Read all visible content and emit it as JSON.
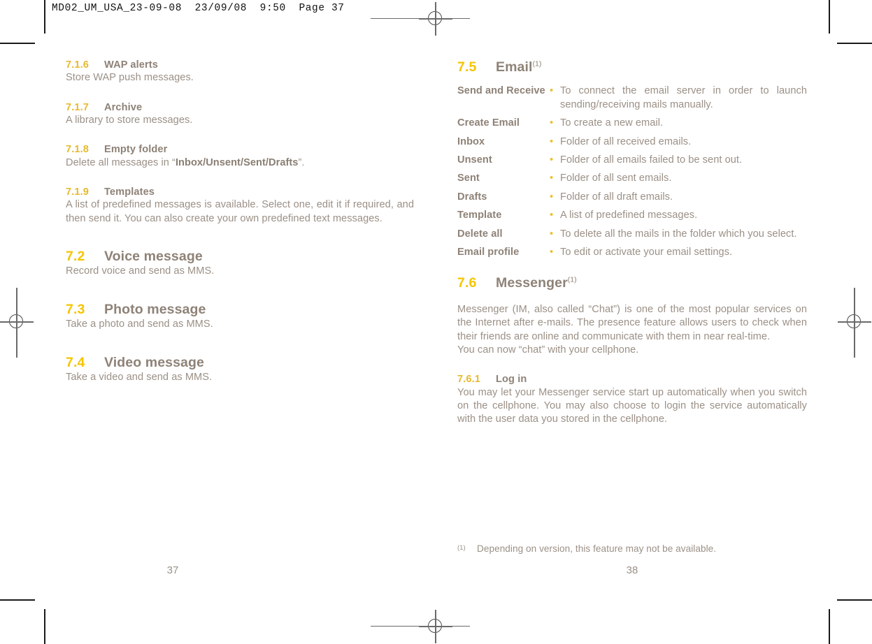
{
  "slug": {
    "text": "MD02_UM_USA_23-09-08  23/09/08  9:50  Page 37"
  },
  "colors": {
    "heading_number_primary": "#f5c500",
    "heading_number_secondary": "#e8b92c",
    "heading_text": "#8e8277",
    "body_text": "#9b9086",
    "bullet": "#eac22e",
    "crop_mark": "#1a1a1a",
    "registration_mark": "#6a6a6a"
  },
  "left_page": {
    "folio": "37",
    "sections": [
      {
        "level": 2,
        "number": "7.1.6",
        "title": "WAP alerts",
        "paragraphs": [
          "Store WAP push messages."
        ]
      },
      {
        "level": 2,
        "number": "7.1.7",
        "title": "Archive",
        "paragraphs": [
          "A library to store messages."
        ]
      },
      {
        "level": 2,
        "number": "7.1.8",
        "title": "Empty folder",
        "paragraph_prefix": "Delete all messages in “",
        "paragraph_bold": "Inbox/Unsent/Sent/Drafts",
        "paragraph_suffix": "”."
      },
      {
        "level": 2,
        "number": "7.1.9",
        "title": "Templates",
        "paragraphs": [
          "A list of predefined messages is available. Select one, edit it if required, and then send it. You can also create your own predefined text messages."
        ]
      },
      {
        "level": 1,
        "number": "7.2",
        "title": "Voice message",
        "paragraphs": [
          "Record voice and send as MMS."
        ]
      },
      {
        "level": 1,
        "number": "7.3",
        "title": "Photo message",
        "paragraphs": [
          "Take a photo and send as MMS."
        ]
      },
      {
        "level": 1,
        "number": "7.4",
        "title": "Video message",
        "paragraphs": [
          "Take a video and send as MMS."
        ]
      }
    ]
  },
  "right_page": {
    "folio": "38",
    "email_section": {
      "number": "7.5",
      "title": "Email",
      "footnote_marker": "(1)",
      "bullet": "•",
      "rows": [
        {
          "term": "Send and Receive",
          "desc": "To connect the email server in order to launch sending/receiving mails manually."
        },
        {
          "term": "Create Email",
          "desc": "To create a new email."
        },
        {
          "term": "Inbox",
          "desc": "Folder of all received emails."
        },
        {
          "term": "Unsent",
          "desc": "Folder of all emails failed to be sent out."
        },
        {
          "term": "Sent",
          "desc": "Folder of all sent emails."
        },
        {
          "term": "Drafts",
          "desc": "Folder of all draft emails."
        },
        {
          "term": "Template",
          "desc": "A list of predefined messages."
        },
        {
          "term": "Delete all",
          "desc": "To delete all the mails in the folder which you select."
        },
        {
          "term": "Email profile",
          "desc": "To edit or activate your email settings."
        }
      ]
    },
    "messenger_section": {
      "number": "7.6",
      "title": "Messenger",
      "footnote_marker": "(1)",
      "paragraph_1": "Messenger (IM, also called “Chat”) is one of the most popular services on the Internet after e-mails. The presence feature allows users to check when their friends are online and communicate with them in near real-time.",
      "paragraph_2": "You can now “chat” with your cellphone."
    },
    "login_section": {
      "number": "7.6.1",
      "title": "Log in",
      "paragraph": "You may let your Messenger service start up automatically when you switch on the cellphone. You may also choose to login the service automatically with the user data you stored in the cellphone."
    },
    "footnote": {
      "marker": "(1)",
      "text": "Depending on version, this feature may not be available."
    }
  }
}
